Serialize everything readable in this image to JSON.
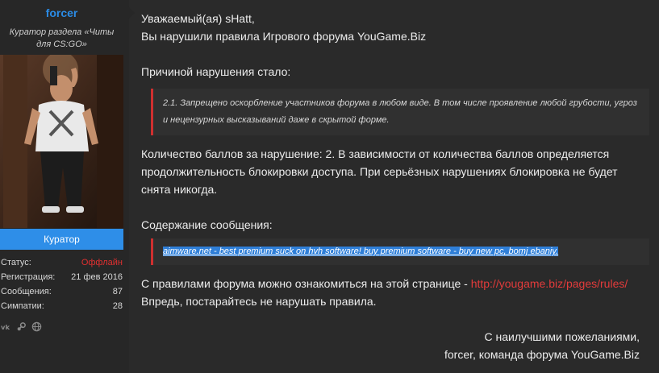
{
  "user": {
    "name": "forcer",
    "title": "Куратор раздела «Читы для CS:GO»",
    "rank": "Куратор",
    "stats": [
      {
        "label": "Статус:",
        "value": "Оффлайн"
      },
      {
        "label": "Регистрация:",
        "value": "21 фев 2016"
      },
      {
        "label": "Сообщения:",
        "value": "87"
      },
      {
        "label": "Симпатии:",
        "value": "28"
      }
    ],
    "social_icons": [
      "vk-icon",
      "steam-icon",
      "globe-icon"
    ]
  },
  "message": {
    "greeting": "Уважаемый(ая) sHatt,",
    "intro": "Вы нарушили правила Игрового форума YouGame.Biz",
    "reason_heading": "Причиной нарушения стало:",
    "reason_quote": "2.1. Запрещено оскорбление участников форума в любом виде. В том числе проявление любой грубости, угроз и нецензурных высказываний даже в скрытой форме.",
    "points_text": "Количество баллов за нарушение: 2. В зависимости от количества баллов определяется продолжительность блокировки доступа. При серьёзных нарушениях блокировка не будет снята никогда.",
    "content_heading": "Содержание сообщения:",
    "content_quote": "aimware.net - best premium suck on hvh software! buy premium software - buy new pc, bomj ebaniy.",
    "rules_text": "С правилами форума можно ознакомиться на этой странице - ",
    "rules_link": "http://yougame.biz/pages/rules/",
    "warning": "Впредь, постарайтесь не нарушать правила.",
    "closing": "С наилучшими пожеланиями,",
    "signature": "forcer, команда форума YouGame.Biz"
  },
  "colors": {
    "username": "#2b8ce6",
    "rank_badge": "#2e8ee8",
    "offline": "#e03030",
    "link": "#e23b3b",
    "quote_border": "#d03030",
    "highlight": "#2f7fd8"
  }
}
